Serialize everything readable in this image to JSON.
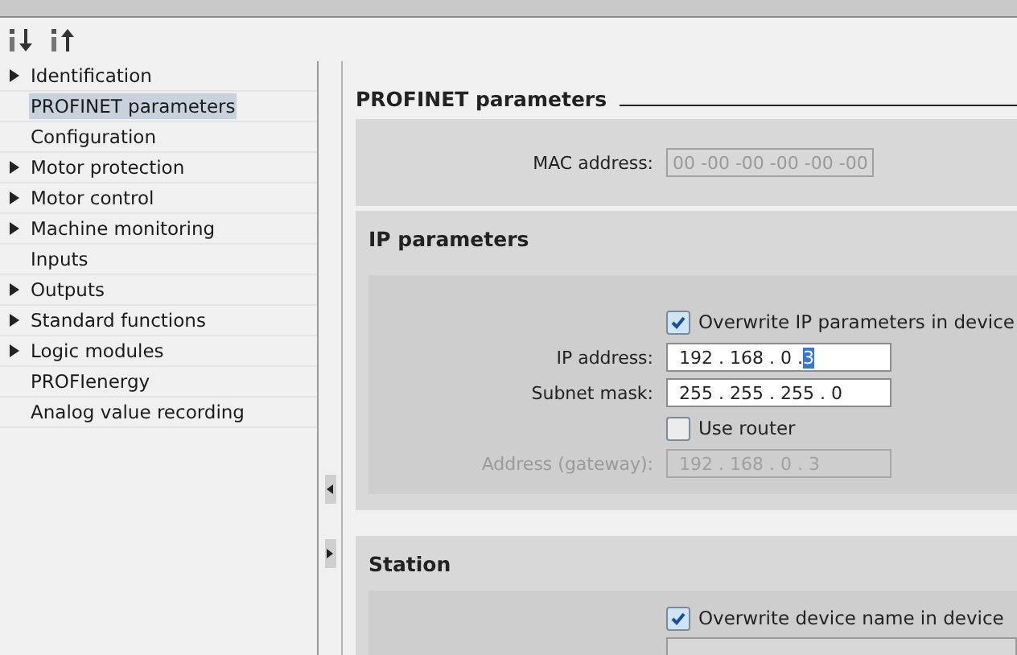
{
  "toolbar": {
    "buttons": [
      {
        "kind": "expand"
      },
      {
        "kind": "collapse"
      }
    ]
  },
  "tree": [
    {
      "label": "Identification",
      "expandable": true,
      "selected": false
    },
    {
      "label": "PROFINET parameters",
      "expandable": false,
      "selected": true
    },
    {
      "label": "Configuration",
      "expandable": false,
      "selected": false
    },
    {
      "label": "Motor protection",
      "expandable": true,
      "selected": false
    },
    {
      "label": "Motor control",
      "expandable": true,
      "selected": false
    },
    {
      "label": "Machine monitoring",
      "expandable": true,
      "selected": false
    },
    {
      "label": "Inputs",
      "expandable": false,
      "selected": false
    },
    {
      "label": "Outputs",
      "expandable": true,
      "selected": false
    },
    {
      "label": "Standard functions",
      "expandable": true,
      "selected": false
    },
    {
      "label": "Logic modules",
      "expandable": true,
      "selected": false
    },
    {
      "label": "PROFIenergy",
      "expandable": false,
      "selected": false
    },
    {
      "label": "Analog value recording",
      "expandable": false,
      "selected": false
    }
  ],
  "page_title": "PROFINET parameters",
  "mac": {
    "label": "MAC address:",
    "value": "00 -00 -00 -00 -00 -00",
    "disabled": true
  },
  "ip_section": {
    "title": "IP parameters",
    "rows": [
      {
        "kind": "checkbox",
        "label": "Overwrite IP parameters in device",
        "checked": true
      },
      {
        "kind": "address",
        "label": "IP address:",
        "disabled": false,
        "parts": [
          {
            "text": "192 . 168 . 0    .",
            "selected": false
          },
          {
            "text": "3",
            "selected": true
          }
        ]
      },
      {
        "kind": "address",
        "label": "Subnet mask:",
        "disabled": false,
        "parts": [
          {
            "text": "255 . 255 . 255 . 0",
            "selected": false
          }
        ]
      },
      {
        "kind": "checkbox",
        "label": "Use router",
        "checked": false
      },
      {
        "kind": "address",
        "label": "Address (gateway):",
        "disabled": true,
        "parts": [
          {
            "text": "192 . 168 . 0    . 3",
            "selected": false
          }
        ]
      }
    ]
  },
  "station_section": {
    "title": "Station",
    "rows": [
      {
        "kind": "checkbox",
        "label": "Overwrite device name in device",
        "checked": true
      }
    ]
  }
}
